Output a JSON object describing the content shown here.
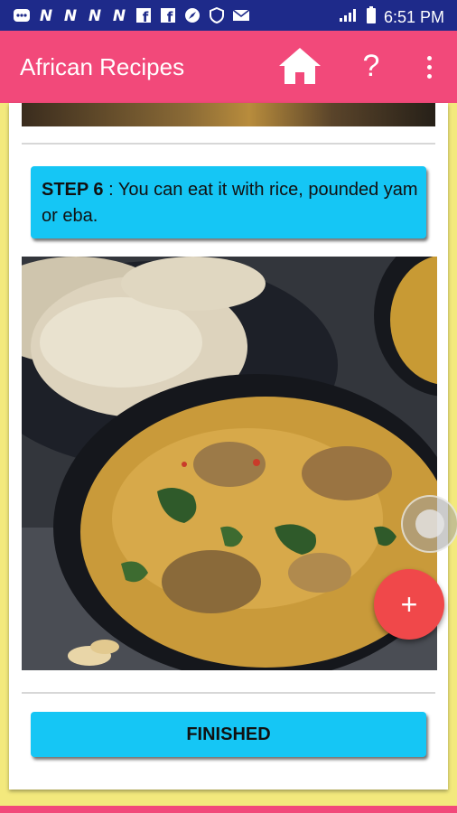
{
  "status_bar": {
    "time": "6:51 PM",
    "left_icons": [
      "notification-icon",
      "n-icon",
      "n-icon",
      "n-icon",
      "n-icon",
      "facebook-icon",
      "facebook-icon",
      "compass-icon",
      "shield-icon",
      "mail-icon"
    ],
    "right_icons": [
      "signal-icon",
      "battery-icon"
    ]
  },
  "app_bar": {
    "title": "African Recipes",
    "actions": [
      "home-icon",
      "help-icon",
      "more-vert-icon"
    ],
    "help_glyph": "?"
  },
  "step": {
    "label": "STEP 6",
    "separator": " : ",
    "text": "You can eat it with rice, pounded yam or eba."
  },
  "finish_button": {
    "label": "FINISHED"
  },
  "fab": {
    "label": "+"
  },
  "colors": {
    "status_bar": "#1e2a8a",
    "app_bar": "#f2497a",
    "background": "#f3e97d",
    "step_box": "#15c6f5",
    "fab": "#f0484a"
  }
}
